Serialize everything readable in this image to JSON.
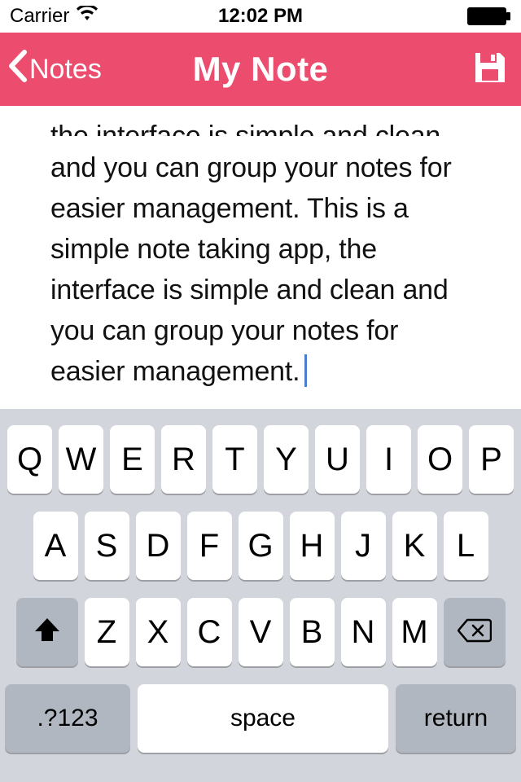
{
  "status": {
    "carrier": "Carrier",
    "time": "12:02 PM"
  },
  "nav": {
    "back_label": "Notes",
    "title": "My Note"
  },
  "note": {
    "partial_top": "the interface is simple and clean",
    "body": "and you can group your notes for easier management. This is a simple note taking app, the interface is simple and clean and you can group your notes for easier management."
  },
  "keyboard": {
    "row1": [
      "Q",
      "W",
      "E",
      "R",
      "T",
      "Y",
      "U",
      "I",
      "O",
      "P"
    ],
    "row2": [
      "A",
      "S",
      "D",
      "F",
      "G",
      "H",
      "J",
      "K",
      "L"
    ],
    "row3": [
      "Z",
      "X",
      "C",
      "V",
      "B",
      "N",
      "M"
    ],
    "mode_key": ".?123",
    "space_key": "space",
    "return_key": "return"
  },
  "colors": {
    "accent": "#ec4c6d"
  }
}
